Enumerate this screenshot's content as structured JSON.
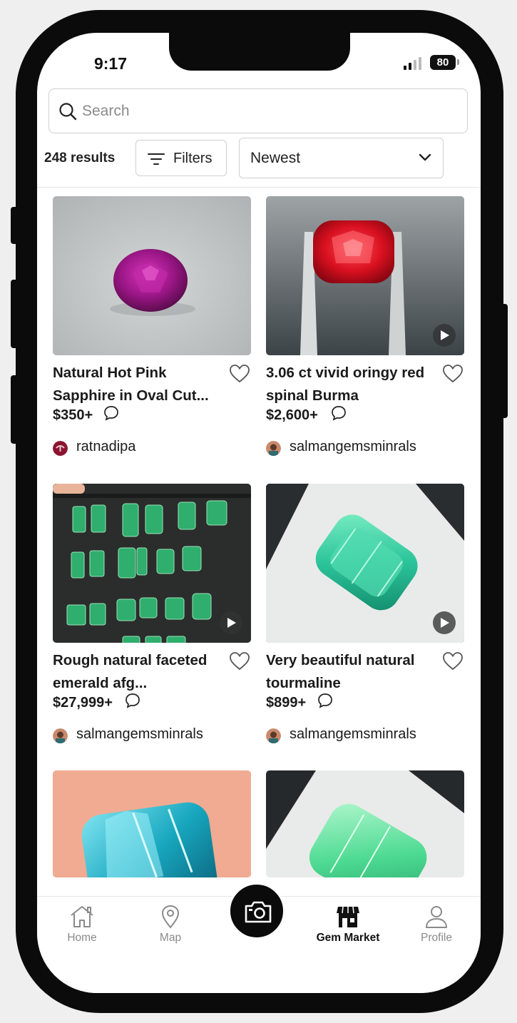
{
  "status_bar": {
    "time": "9:17",
    "battery": "80"
  },
  "search": {
    "placeholder": "Search",
    "value": ""
  },
  "toolbar": {
    "results_count": "248 results",
    "filters_label": "Filters",
    "sort_selected": "Newest"
  },
  "listings": [
    {
      "title": "Natural Hot Pink Sapphire in Oval Cut...",
      "price": "$350+",
      "seller": "ratnadipa",
      "has_video": false,
      "image": "pink-sapphire-photo"
    },
    {
      "title": "3.06 ct vivid oringy red spinal Burma",
      "price": "$2,600+",
      "seller": "salmangemsminrals",
      "has_video": true,
      "image": "red-spinel-photo"
    },
    {
      "title": "Rough natural faceted emerald afg...",
      "price": "$27,999+",
      "seller": "salmangemsminrals",
      "has_video": true,
      "image": "rough-emeralds-photo"
    },
    {
      "title": "Very beautiful natural tourmaline",
      "price": "$899+",
      "seller": "salmangemsminrals",
      "has_video": true,
      "image": "green-tourmaline-photo"
    },
    {
      "title": "",
      "price": "",
      "seller": "",
      "has_video": false,
      "image": "blue-tourmaline-photo"
    },
    {
      "title": "",
      "price": "",
      "seller": "",
      "has_video": false,
      "image": "mint-tourmaline-photo"
    }
  ],
  "bottom_nav": {
    "items": [
      {
        "label": "Home",
        "icon": "home-icon",
        "active": false
      },
      {
        "label": "Map",
        "icon": "map-pin-icon",
        "active": false
      },
      {
        "label": "",
        "icon": "camera-icon",
        "active": false
      },
      {
        "label": "Gem Market",
        "icon": "store-icon",
        "active": true
      },
      {
        "label": "Profile",
        "icon": "user-icon",
        "active": false
      }
    ]
  },
  "colors": {
    "accent": "#111111",
    "border": "#cfcfcf",
    "inactive": "#8a8a8a"
  }
}
